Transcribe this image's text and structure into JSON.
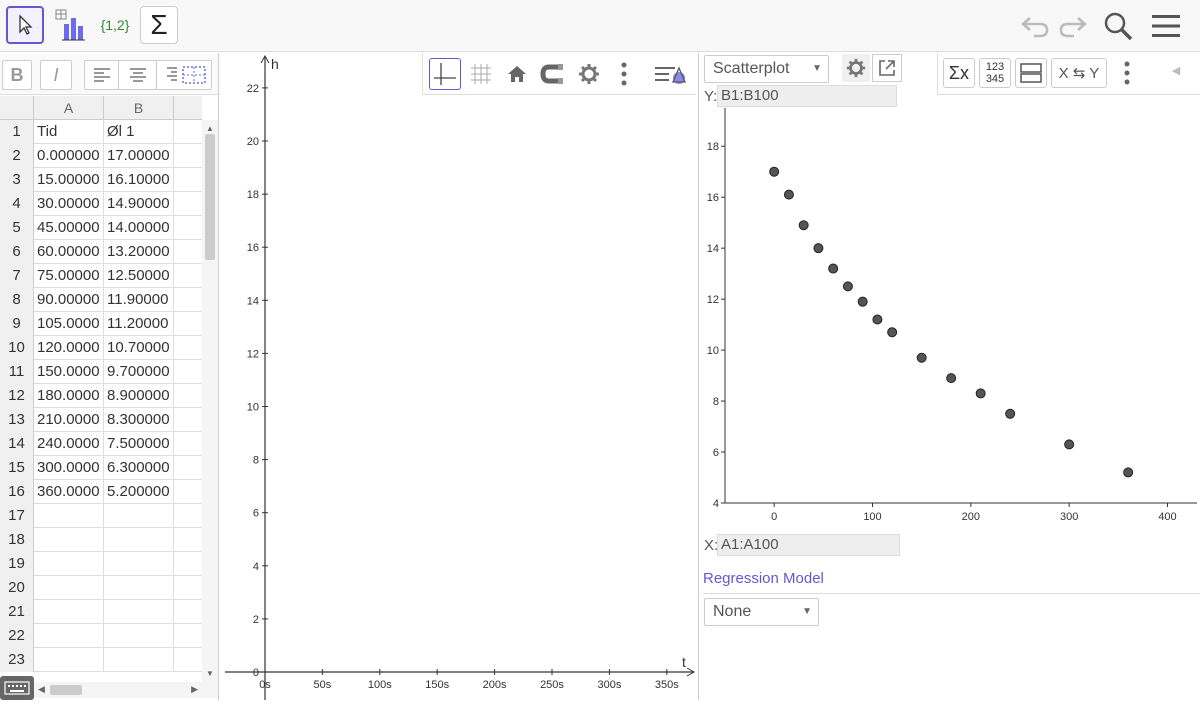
{
  "spreadsheet": {
    "col_headers": [
      "A",
      "B"
    ],
    "rows": [
      {
        "n": "1",
        "a": "Tid",
        "b": "Øl 1"
      },
      {
        "n": "2",
        "a": "0.000000",
        "b": "17.00000"
      },
      {
        "n": "3",
        "a": "15.00000",
        "b": "16.10000"
      },
      {
        "n": "4",
        "a": "30.00000",
        "b": "14.90000"
      },
      {
        "n": "5",
        "a": "45.00000",
        "b": "14.00000"
      },
      {
        "n": "6",
        "a": "60.00000",
        "b": "13.20000"
      },
      {
        "n": "7",
        "a": "75.00000",
        "b": "12.50000"
      },
      {
        "n": "8",
        "a": "90.00000",
        "b": "11.90000"
      },
      {
        "n": "9",
        "a": "105.0000",
        "b": "11.20000"
      },
      {
        "n": "10",
        "a": "120.0000",
        "b": "10.70000"
      },
      {
        "n": "11",
        "a": "150.0000",
        "b": "9.700000"
      },
      {
        "n": "12",
        "a": "180.0000",
        "b": "8.900000"
      },
      {
        "n": "13",
        "a": "210.0000",
        "b": "8.300000"
      },
      {
        "n": "14",
        "a": "240.0000",
        "b": "7.500000"
      },
      {
        "n": "15",
        "a": "300.0000",
        "b": "6.300000"
      },
      {
        "n": "16",
        "a": "360.0000",
        "b": "5.200000"
      },
      {
        "n": "17",
        "a": "",
        "b": ""
      },
      {
        "n": "18",
        "a": "",
        "b": ""
      },
      {
        "n": "19",
        "a": "",
        "b": ""
      },
      {
        "n": "20",
        "a": "",
        "b": ""
      },
      {
        "n": "21",
        "a": "",
        "b": ""
      },
      {
        "n": "22",
        "a": "",
        "b": ""
      },
      {
        "n": "23",
        "a": "",
        "b": ""
      }
    ],
    "bold_label": "B",
    "italic_label": "I"
  },
  "toolbar": {
    "list_label": "{1,2}",
    "sum_label": "Σ"
  },
  "graphics": {
    "x_axis_label": "t",
    "y_axis_label": "h",
    "x_ticks": [
      "0s",
      "50s",
      "100s",
      "150s",
      "200s",
      "250s",
      "300s",
      "350s"
    ],
    "y_ticks": [
      "0",
      "2",
      "4",
      "6",
      "8",
      "10",
      "12",
      "14",
      "16",
      "18",
      "20",
      "22"
    ]
  },
  "stats": {
    "plot_type": "Scatterplot",
    "y_label": "Y:",
    "y_range": "B1:B100",
    "x_label": "X:",
    "x_range": "A1:A100",
    "regression_title": "Regression Model",
    "regression_value": "None",
    "sigma_x_label": "Σx",
    "numbers_label_top": "123",
    "numbers_label_bottom": "345",
    "swap_label": "X ⇆ Y"
  },
  "chart_data": {
    "type": "scatter",
    "x": [
      0,
      15,
      30,
      45,
      60,
      75,
      90,
      105,
      120,
      150,
      180,
      210,
      240,
      300,
      360
    ],
    "y": [
      17,
      16.1,
      14.9,
      14,
      13.2,
      12.5,
      11.9,
      11.2,
      10.7,
      9.7,
      8.9,
      8.3,
      7.5,
      6.3,
      5.2
    ],
    "x_ticks": [
      "0",
      "100",
      "200",
      "300",
      "400"
    ],
    "y_ticks": [
      "4",
      "6",
      "8",
      "10",
      "12",
      "14",
      "16",
      "18"
    ],
    "xlim": [
      -50,
      430
    ],
    "ylim": [
      4,
      19.5
    ],
    "colors": {
      "point": "#555555"
    }
  }
}
